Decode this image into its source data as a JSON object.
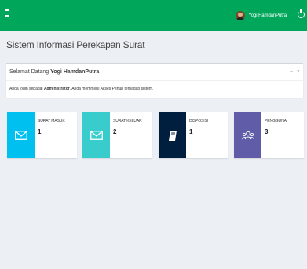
{
  "header": {
    "user_name": "Yogi HamdanPutra"
  },
  "page": {
    "title": "Sistem Informasi Perekapan Surat"
  },
  "welcome": {
    "greeting": "Selamat Datang ",
    "name": "Yogi HamdanPutra",
    "minimize": "−",
    "close": "×",
    "login_prefix": "Anda login sebagai ",
    "role": "Administrator",
    "login_suffix": ". Anda memmiliki Akses Penuh terhadap sistem."
  },
  "cards": [
    {
      "label": "SURAT MASUK",
      "value": "1",
      "color": "#00c0ef",
      "icon": "envelope-icon"
    },
    {
      "label": "SURAT KELUAR",
      "value": "2",
      "color": "#39cccc",
      "icon": "envelope-icon"
    },
    {
      "label": "DISPOSISI",
      "value": "1",
      "color": "#001f3f",
      "icon": "book-icon"
    },
    {
      "label": "PENGGUNA",
      "value": "3",
      "color": "#605ca8",
      "icon": "users-icon"
    }
  ]
}
